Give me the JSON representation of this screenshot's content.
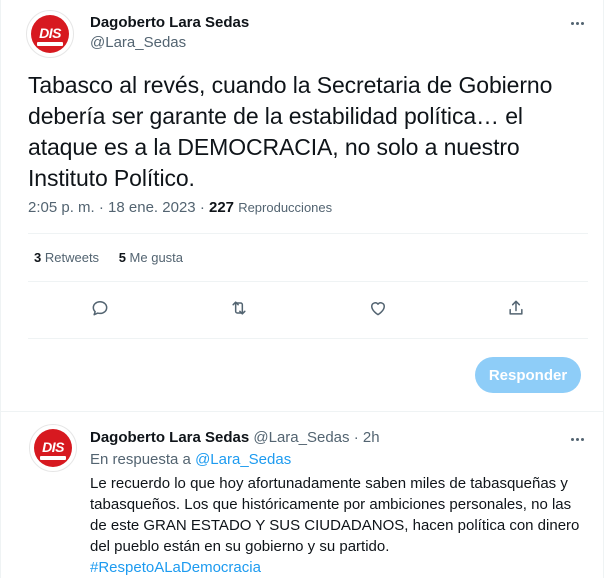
{
  "colors": {
    "accent": "#1d9bf0",
    "reply_button_bg": "#8ecdf8",
    "secondary_text": "#536471",
    "avatar_red": "#d71920"
  },
  "main_tweet": {
    "author": {
      "display_name": "Dagoberto Lara Sedas",
      "handle": "@Lara_Sedas",
      "avatar_text": "DIS"
    },
    "text": "Tabasco al revés, cuando la Secretaria de Gobierno debería ser garante de la estabilidad política… el ataque es a la DEMOCRACIA, no solo a nuestro Instituto Político.",
    "time": "2:05 p. m.",
    "separator": "·",
    "date": "18 ene. 2023",
    "views_count": "227",
    "views_label": "Reproducciones",
    "retweets_count": "3",
    "retweets_label": "Retweets",
    "likes_count": "5",
    "likes_label": "Me gusta",
    "actions": [
      "reply-icon",
      "retweet-icon",
      "like-icon",
      "share-icon"
    ],
    "reply_button_label": "Responder"
  },
  "reply_tweet": {
    "author": {
      "display_name": "Dagoberto Lara Sedas",
      "handle": "@Lara_Sedas",
      "avatar_text": "DIS"
    },
    "time_ago": "2h",
    "separator": "·",
    "replying_to_label": "En respuesta a",
    "replying_to_handle": "@Lara_Sedas",
    "text": "Le recuerdo lo que hoy afortunadamente saben miles de tabasqueñas y tabasqueños. Los que históricamente por ambiciones personales, no las de este GRAN ESTADO Y SUS CIUDADANOS, hacen política con dinero del pueblo están en su gobierno y su partido.",
    "hashtag": "#RespetoALaDemocracia"
  }
}
